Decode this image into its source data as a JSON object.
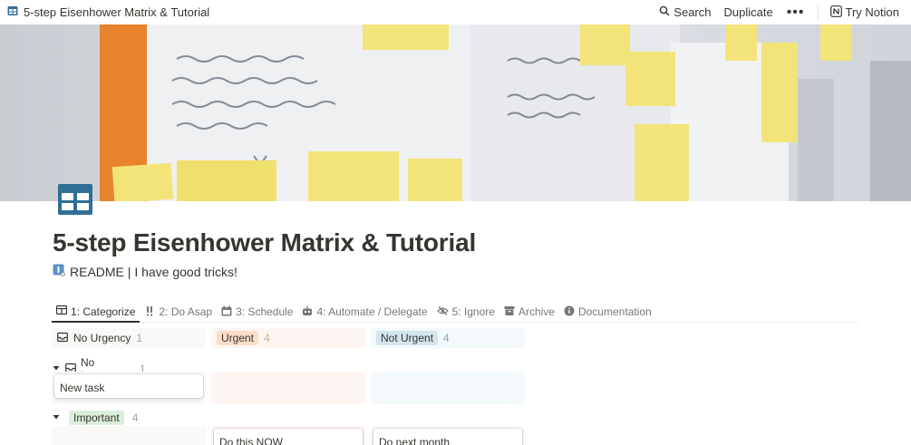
{
  "topbar": {
    "breadcrumb": "5-step Eisenhower Matrix & Tutorial",
    "search_label": "Search",
    "duplicate_label": "Duplicate",
    "more_label": "•••",
    "try_notion_label": "Try Notion"
  },
  "page": {
    "title": "5-step Eisenhower Matrix & Tutorial",
    "readme_label": "README | I have good tricks!"
  },
  "tabs": [
    {
      "label": "1: Categorize",
      "icon": "table-icon"
    },
    {
      "label": "2: Do Asap",
      "icon": "exclamation-icon"
    },
    {
      "label": "3: Schedule",
      "icon": "calendar-icon"
    },
    {
      "label": "4: Automate / Delegate",
      "icon": "robot-icon"
    },
    {
      "label": "5: Ignore",
      "icon": "eye-slash-icon"
    },
    {
      "label": "Archive",
      "icon": "archive-icon"
    },
    {
      "label": "Documentation",
      "icon": "info-icon"
    }
  ],
  "board": {
    "columns": [
      {
        "label": "No Urgency",
        "count": "1"
      },
      {
        "label": "Urgent",
        "count": "4",
        "color": "#fbecdd"
      },
      {
        "label": "Not Urgent",
        "count": "4",
        "color": "#e7f3f8"
      }
    ],
    "groups": [
      {
        "label": "No Importance",
        "count": "1",
        "cards": [
          "New task",
          "",
          ""
        ]
      },
      {
        "label": "Important",
        "count": "4",
        "color": "#dbeddb",
        "cards": [
          "",
          "Do this NOW",
          "Do next month"
        ]
      }
    ]
  },
  "colors": {
    "urgent_bg": "#fdf5f2",
    "urgent_pill": "#fadec9",
    "not_urgent_bg": "#f4f9fc",
    "not_urgent_pill": "#d3e5ef",
    "important_pill": "#dbeddb",
    "neutral_bg": "#f9f9f8"
  }
}
